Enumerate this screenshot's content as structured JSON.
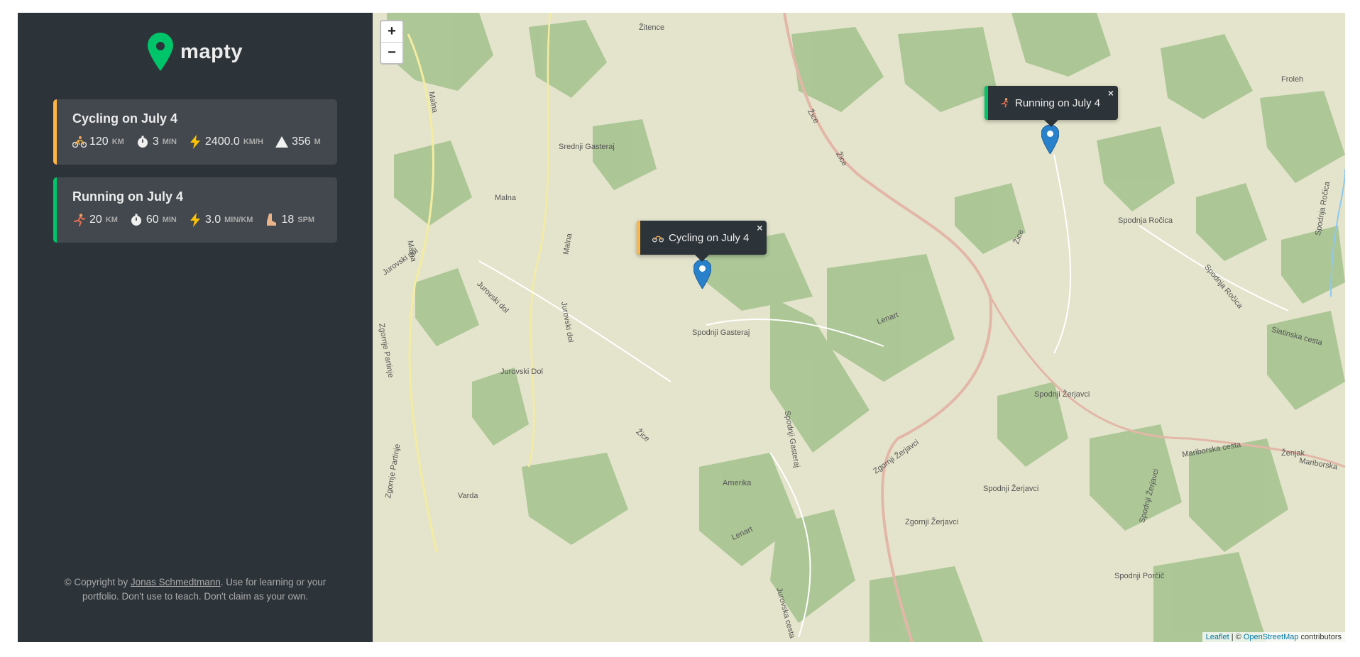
{
  "logo": {
    "text": "mapty"
  },
  "workouts": [
    {
      "type": "cycling",
      "title": "Cycling on July 4",
      "details": [
        {
          "icon": "cyclist-icon",
          "value": "120",
          "unit": "km"
        },
        {
          "icon": "stopwatch-icon",
          "value": "3",
          "unit": "min"
        },
        {
          "icon": "lightning-icon",
          "value": "2400.0",
          "unit": "km/h"
        },
        {
          "icon": "mountain-icon",
          "value": "356",
          "unit": "m"
        }
      ]
    },
    {
      "type": "running",
      "title": "Running on July 4",
      "details": [
        {
          "icon": "runner-icon",
          "value": "20",
          "unit": "km"
        },
        {
          "icon": "stopwatch-icon",
          "value": "60",
          "unit": "min"
        },
        {
          "icon": "lightning-icon",
          "value": "3.0",
          "unit": "min/km"
        },
        {
          "icon": "footprint-icon",
          "value": "18",
          "unit": "spm"
        }
      ]
    }
  ],
  "copyright": {
    "prefix": "© Copyright by ",
    "author": "Jonas Schmedtmann",
    "suffix": ". Use for learning or your portfolio. Don't use to teach. Don't claim as your own."
  },
  "map": {
    "zoom_in": "+",
    "zoom_out": "−",
    "popups": [
      {
        "type": "cycling",
        "label": "Cycling on July 4",
        "close": "×"
      },
      {
        "type": "running",
        "label": "Running on July 4",
        "close": "×"
      }
    ],
    "attribution": {
      "leaflet": "Leaflet",
      "sep": " | © ",
      "osm": "OpenStreetMap",
      "suffix": " contributors"
    },
    "labels": [
      "Žitence",
      "Froleh",
      "Srednji Gasteraj",
      "Malna",
      "Malna",
      "Malna",
      "Malna",
      "Jurovski dol",
      "Jurovski dol",
      "Jurovski dol",
      "Žice",
      "Žice",
      "Žice",
      "Žice",
      "Spodnja Ročica",
      "Spodnja Ročica",
      "Spodnja Ročica",
      "Slatinska cesta",
      "Spodnji Gasteraj",
      "Lenart",
      "Lenart",
      "Jurovski Dol",
      "Zgornje Partinje",
      "Zgornje Partinje",
      "Spodnji Žerjavci",
      "Zgornji Žerjavci",
      "Mariborska cesta",
      "Mariborska",
      "Ženjak",
      "Spodnji Žerjavci",
      "Zgornji Žerjavci",
      "Varda",
      "Amerika",
      "Spodnji Žerjavci",
      "Spodnji Porčič",
      "Jurovska cesta",
      "Spodnji Gasteraj"
    ]
  }
}
